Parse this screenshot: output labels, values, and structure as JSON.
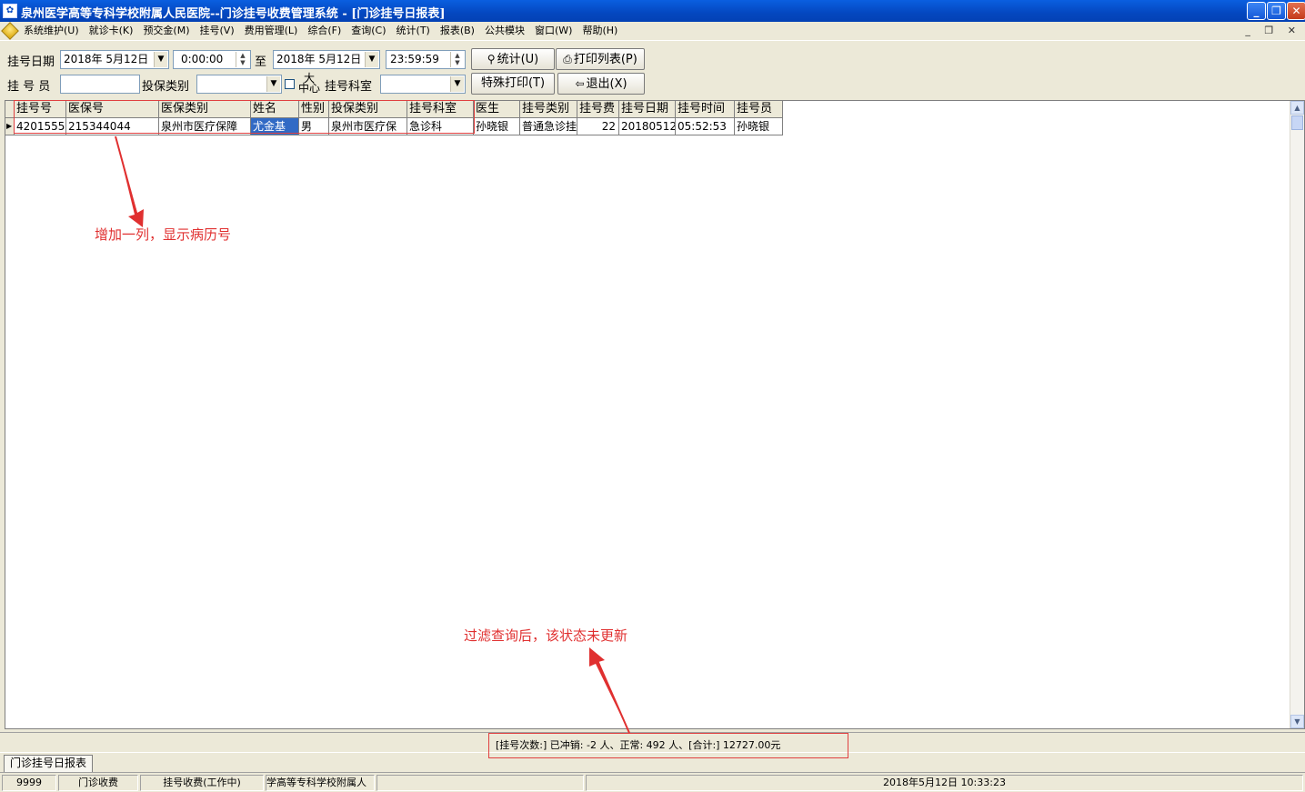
{
  "window": {
    "title": "泉州医学高等专科学校附属人民医院--门诊挂号收费管理系统 - [门诊挂号日报表]",
    "min_glyph": "_",
    "max_glyph": "❐",
    "close_glyph": "✕"
  },
  "menu": {
    "items": [
      "系统维护(U)",
      "就诊卡(K)",
      "预交金(M)",
      "挂号(V)",
      "费用管理(L)",
      "综合(F)",
      "查询(C)",
      "统计(T)",
      "报表(B)",
      "公共模块",
      "窗口(W)",
      "帮助(H)"
    ],
    "mdi_controls": "_ ❐ ✕"
  },
  "toolbar": {
    "date_label": "挂号日期",
    "start_date": "2018年 5月12日",
    "start_time": "0:00:00",
    "to_label": "至",
    "end_date": "2018年 5月12日",
    "end_time": "23:59:59",
    "stats_button": "统计(U)",
    "print_list_button": "打印列表(P)",
    "registrar_label": "挂 号 员",
    "registrar_value": "",
    "insurance_type_label": "投保类别",
    "insurance_type_value": "",
    "big_center_top": "大",
    "big_center_bottom": "中心",
    "dept_label": "挂号科室",
    "dept_value": "",
    "special_print_button": "特殊打印(T)",
    "exit_button": "退出(X)"
  },
  "grid": {
    "columns": [
      "挂号号",
      "医保号",
      "医保类别",
      "姓名",
      "性别",
      "投保类别",
      "挂号科室",
      "医生",
      "挂号类别",
      "挂号费",
      "挂号日期",
      "挂号时间",
      "挂号员"
    ],
    "rows": [
      [
        "4201555",
        "215344044",
        "泉州市医疗保障",
        "尤金基",
        "男",
        "泉州市医疗保",
        "急诊科",
        "孙晓银",
        "普通急诊挂",
        "22",
        "20180512",
        "05:52:53",
        "孙晓银"
      ]
    ]
  },
  "annotations": {
    "add_column_note": "增加一列，显示病历号",
    "status_note": "过滤查询后，该状态未更新",
    "color": "#e03030"
  },
  "summary": {
    "text": "[挂号次数:] 已冲销: -2 人、正常: 492 人、[合计:] 12727.00元"
  },
  "tabs": [
    "门诊挂号日报表"
  ],
  "statusbar": {
    "panels": [
      "9999",
      "门诊收费",
      "挂号收费(工作中)",
      "学高等专科学校附属人",
      "",
      "2018年5月12日 10:33:23"
    ]
  }
}
